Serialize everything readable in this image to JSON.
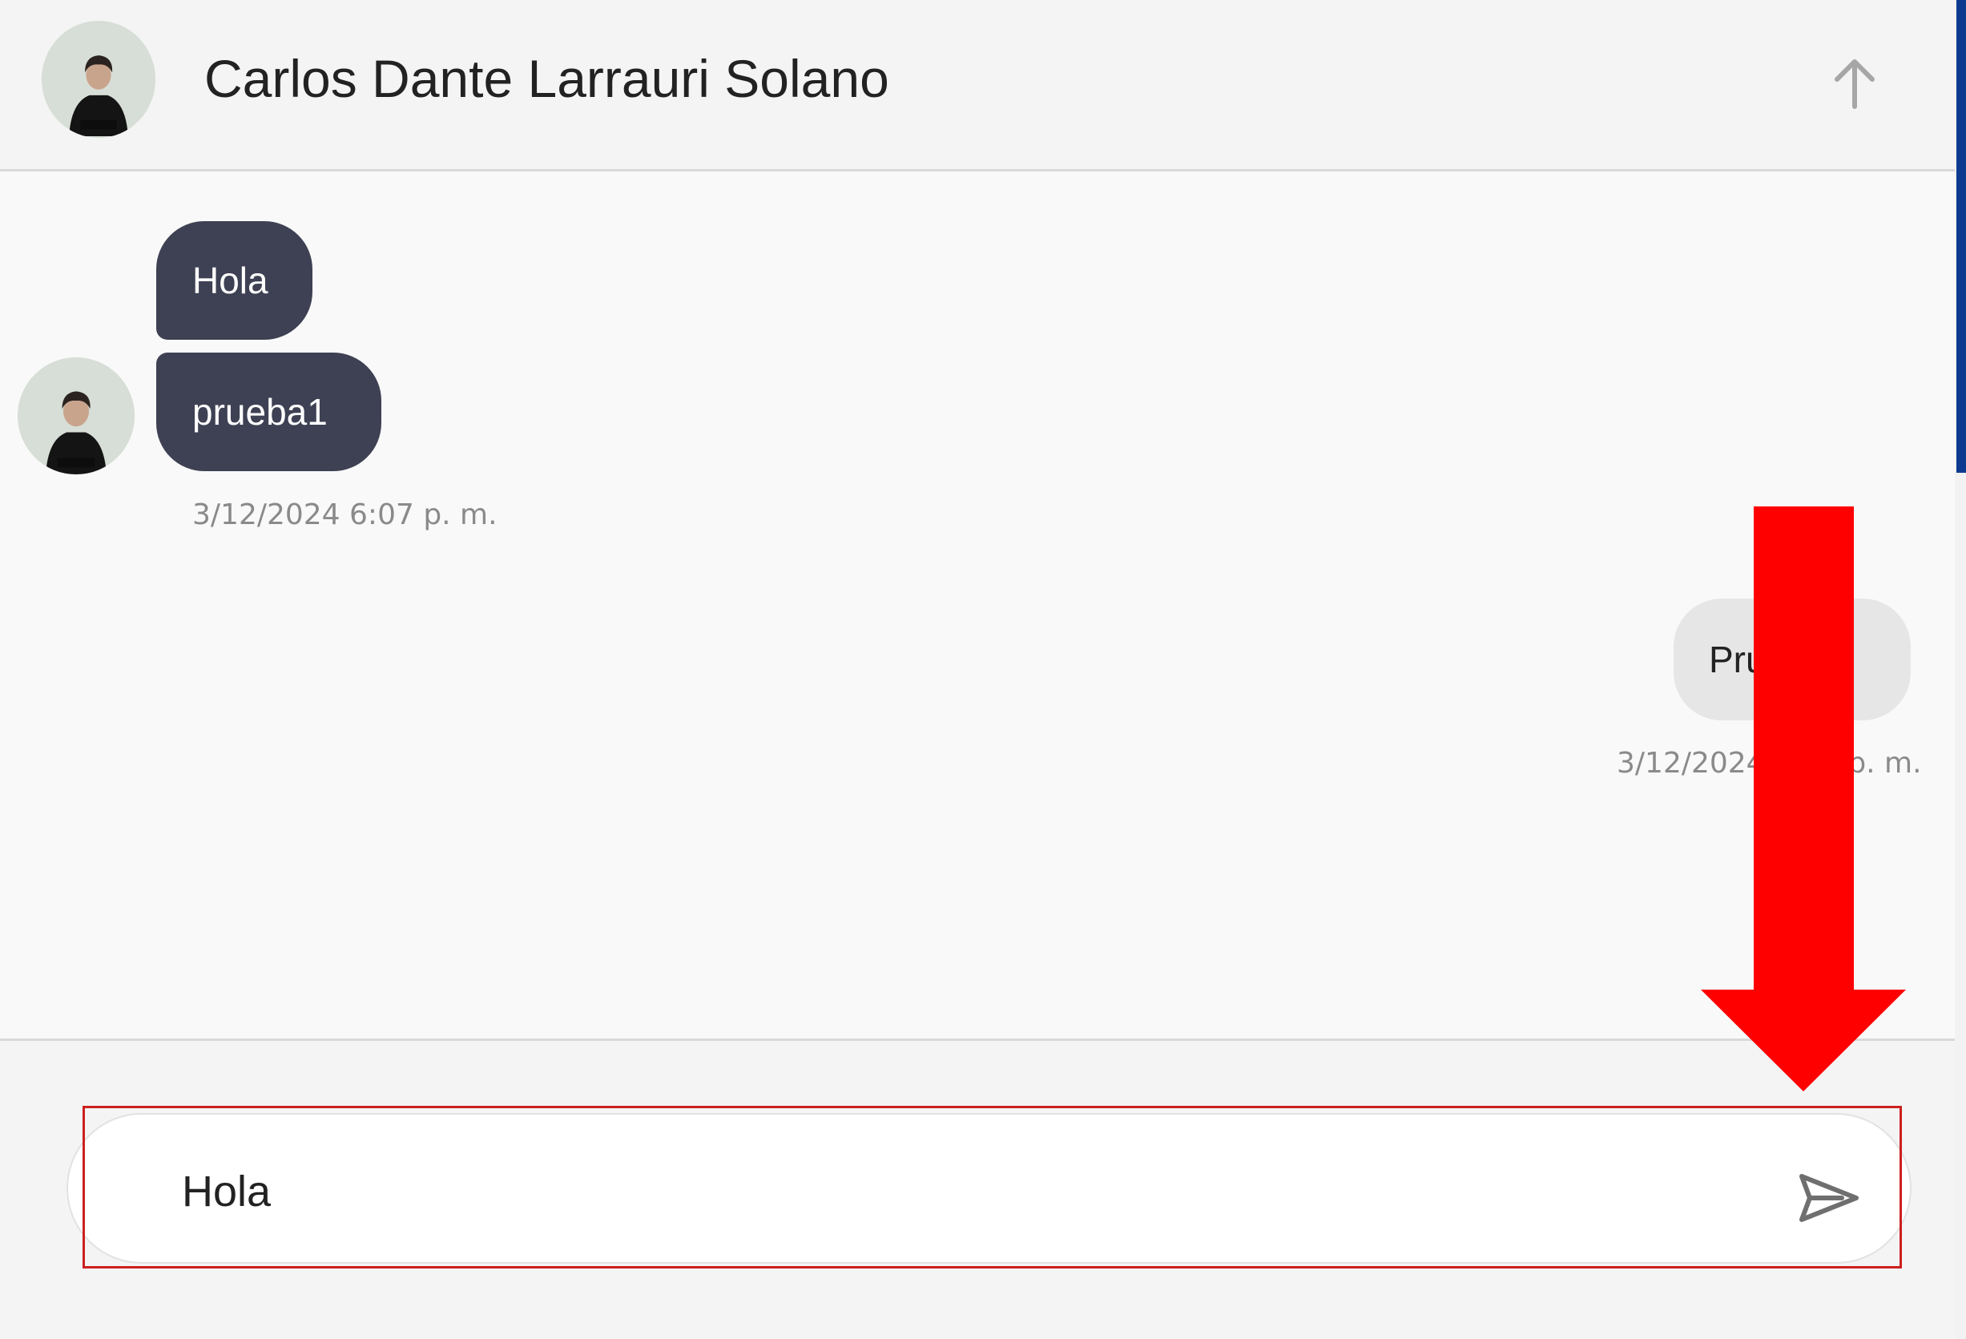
{
  "header": {
    "contact_name": "Carlos Dante Larrauri Solano"
  },
  "icons": {
    "scroll_top": "arrow-up-icon",
    "send": "send-icon",
    "avatar": "user-avatar"
  },
  "messages": [
    {
      "text": "Hola",
      "direction": "incoming"
    },
    {
      "text": "prueba1",
      "direction": "incoming"
    },
    {
      "text": "Prueba2",
      "direction": "outgoing"
    }
  ],
  "timestamps": {
    "incoming_group": "3/12/2024 6:07 p. m.",
    "outgoing_group": "3/12/2024 6:07 p. m."
  },
  "composer": {
    "value": "Hola"
  },
  "colors": {
    "incoming_bubble": "#3e4153",
    "outgoing_bubble": "#e6e6e6",
    "annotation_red": "#ff0000",
    "scrollbar": "#0d3a8e"
  }
}
